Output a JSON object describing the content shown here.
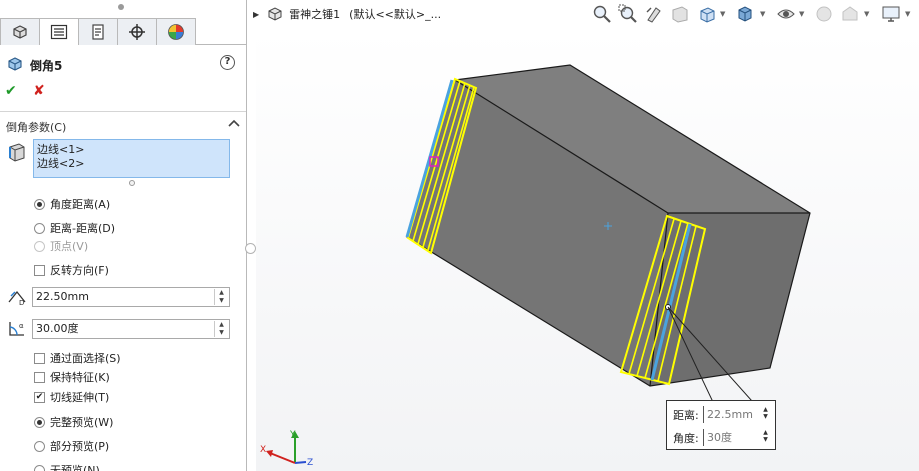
{
  "panel": {
    "tabs": [
      "feature-manager",
      "property-manager",
      "configuration-manager",
      "dimxpert-manager",
      "display-manager"
    ],
    "feature_title": "倒角5",
    "help_label": "?",
    "ok_label": "✔",
    "cancel_label": "✘",
    "section_title": "倒角参数(C)",
    "edges": [
      "边线<1>",
      "边线<2>"
    ],
    "chamfer_types": [
      {
        "label": "角度距离(A)",
        "selected": true,
        "enabled": true
      },
      {
        "label": "距离-距离(D)",
        "selected": false,
        "enabled": true
      },
      {
        "label": "顶点(V)",
        "selected": false,
        "enabled": false
      }
    ],
    "flip_direction_label": "反转方向(F)",
    "flip_direction_checked": false,
    "distance_value": "22.50mm",
    "angle_value": "30.00度",
    "select_through_faces_label": "通过面选择(S)",
    "select_through_faces_checked": false,
    "keep_features_label": "保持特征(K)",
    "keep_features_checked": false,
    "tangent_propagation_label": "切线延伸(T)",
    "tangent_propagation_checked": true,
    "preview_options": [
      {
        "label": "完整预览(W)",
        "selected": true
      },
      {
        "label": "部分预览(P)",
        "selected": false
      },
      {
        "label": "无预览(N)",
        "selected": false
      }
    ]
  },
  "toolbar": {
    "document_name": "雷神之锤1",
    "configuration": "(默认<<默认>_..."
  },
  "viewport": {
    "callout": {
      "distance_label": "距离:",
      "distance_value": "22.5mm",
      "angle_label": "角度:",
      "angle_value": "30度"
    }
  },
  "colors": {
    "model_gray": "#7b7b7b",
    "highlight_yellow": "#ffff00",
    "edge_blue": "#4aa3df",
    "selection_bg": "#cfe4fb"
  }
}
